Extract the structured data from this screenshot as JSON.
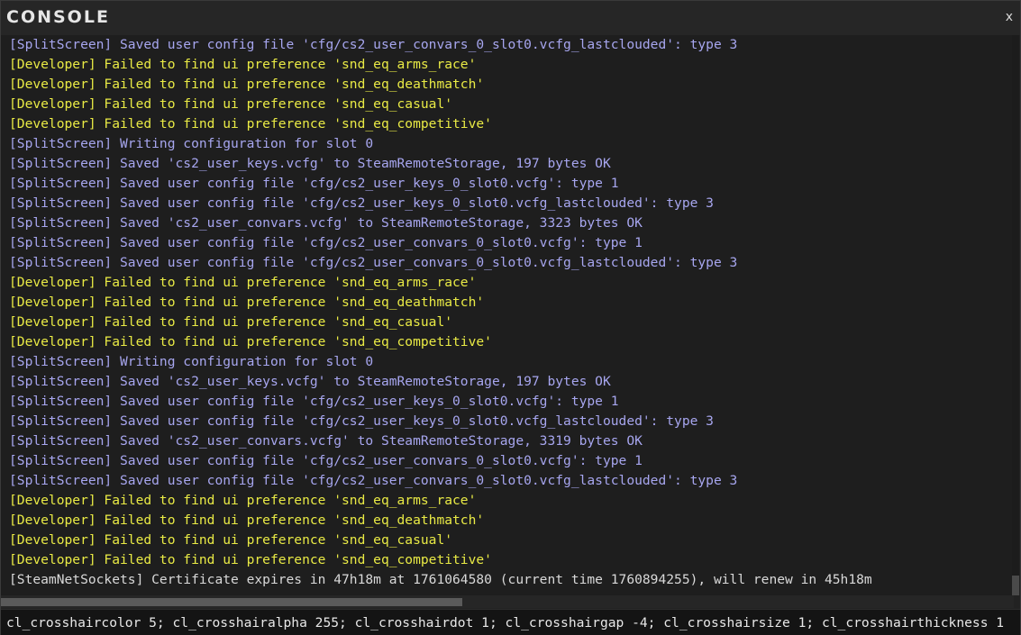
{
  "window": {
    "title": "CONSOLE",
    "close_label": "x"
  },
  "colors": {
    "splitscreen": "#a7a6ef",
    "developer": "#e9ea45",
    "steamnetsockets": "#d9d9d9"
  },
  "log": [
    {
      "text": "[SplitScreen] Saved user config file 'cfg/cs2_user_convars_0_slot0.vcfg_lastclouded': type 3",
      "type": "splitscreen"
    },
    {
      "text": "[Developer] Failed to find ui preference 'snd_eq_arms_race'",
      "type": "developer"
    },
    {
      "text": "[Developer] Failed to find ui preference 'snd_eq_deathmatch'",
      "type": "developer"
    },
    {
      "text": "[Developer] Failed to find ui preference 'snd_eq_casual'",
      "type": "developer"
    },
    {
      "text": "[Developer] Failed to find ui preference 'snd_eq_competitive'",
      "type": "developer"
    },
    {
      "text": "[SplitScreen] Writing configuration for slot 0",
      "type": "splitscreen"
    },
    {
      "text": "[SplitScreen] Saved 'cs2_user_keys.vcfg' to SteamRemoteStorage, 197 bytes OK",
      "type": "splitscreen"
    },
    {
      "text": "[SplitScreen] Saved user config file 'cfg/cs2_user_keys_0_slot0.vcfg': type 1",
      "type": "splitscreen"
    },
    {
      "text": "[SplitScreen] Saved user config file 'cfg/cs2_user_keys_0_slot0.vcfg_lastclouded': type 3",
      "type": "splitscreen"
    },
    {
      "text": "[SplitScreen] Saved 'cs2_user_convars.vcfg' to SteamRemoteStorage, 3323 bytes OK",
      "type": "splitscreen"
    },
    {
      "text": "[SplitScreen] Saved user config file 'cfg/cs2_user_convars_0_slot0.vcfg': type 1",
      "type": "splitscreen"
    },
    {
      "text": "[SplitScreen] Saved user config file 'cfg/cs2_user_convars_0_slot0.vcfg_lastclouded': type 3",
      "type": "splitscreen"
    },
    {
      "text": "[Developer] Failed to find ui preference 'snd_eq_arms_race'",
      "type": "developer"
    },
    {
      "text": "[Developer] Failed to find ui preference 'snd_eq_deathmatch'",
      "type": "developer"
    },
    {
      "text": "[Developer] Failed to find ui preference 'snd_eq_casual'",
      "type": "developer"
    },
    {
      "text": "[Developer] Failed to find ui preference 'snd_eq_competitive'",
      "type": "developer"
    },
    {
      "text": "[SplitScreen] Writing configuration for slot 0",
      "type": "splitscreen"
    },
    {
      "text": "[SplitScreen] Saved 'cs2_user_keys.vcfg' to SteamRemoteStorage, 197 bytes OK",
      "type": "splitscreen"
    },
    {
      "text": "[SplitScreen] Saved user config file 'cfg/cs2_user_keys_0_slot0.vcfg': type 1",
      "type": "splitscreen"
    },
    {
      "text": "[SplitScreen] Saved user config file 'cfg/cs2_user_keys_0_slot0.vcfg_lastclouded': type 3",
      "type": "splitscreen"
    },
    {
      "text": "[SplitScreen] Saved 'cs2_user_convars.vcfg' to SteamRemoteStorage, 3319 bytes OK",
      "type": "splitscreen"
    },
    {
      "text": "[SplitScreen] Saved user config file 'cfg/cs2_user_convars_0_slot0.vcfg': type 1",
      "type": "splitscreen"
    },
    {
      "text": "[SplitScreen] Saved user config file 'cfg/cs2_user_convars_0_slot0.vcfg_lastclouded': type 3",
      "type": "splitscreen"
    },
    {
      "text": "[Developer] Failed to find ui preference 'snd_eq_arms_race'",
      "type": "developer"
    },
    {
      "text": "[Developer] Failed to find ui preference 'snd_eq_deathmatch'",
      "type": "developer"
    },
    {
      "text": "[Developer] Failed to find ui preference 'snd_eq_casual'",
      "type": "developer"
    },
    {
      "text": "[Developer] Failed to find ui preference 'snd_eq_competitive'",
      "type": "developer"
    },
    {
      "text": "[SteamNetSockets] Certificate expires in 47h18m at 1761064580 (current time 1760894255), will renew in 45h18m",
      "type": "steamnetsockets"
    }
  ],
  "input": {
    "value": "cl_crosshaircolor 5; cl_crosshairalpha 255; cl_crosshairdot 1; cl_crosshairgap -4; cl_crosshairsize 1; cl_crosshairthickness 1",
    "placeholder": ""
  }
}
